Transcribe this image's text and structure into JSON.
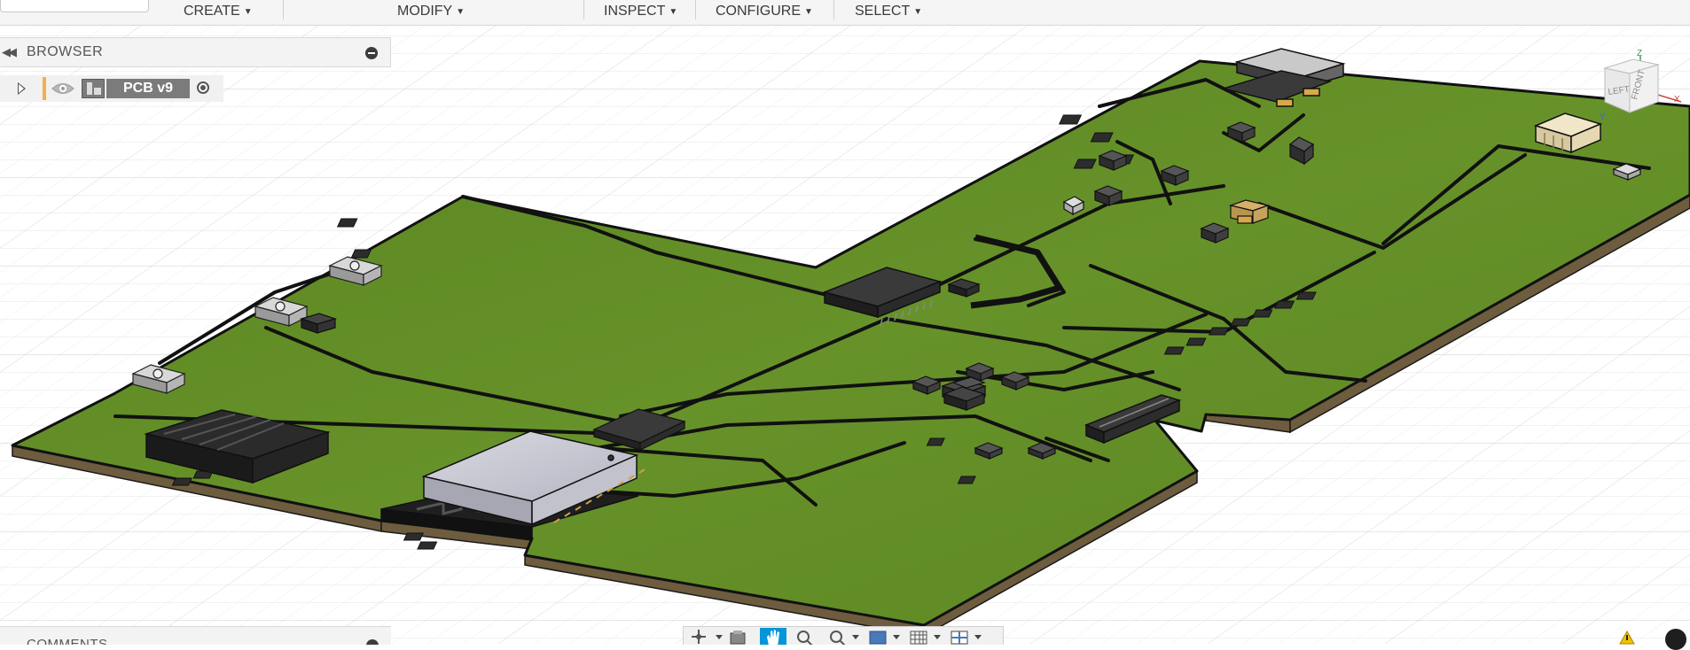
{
  "toolbar": {
    "menus": [
      {
        "label": "CREATE"
      },
      {
        "label": "MODIFY"
      },
      {
        "label": "INSPECT"
      },
      {
        "label": "CONFIGURE"
      },
      {
        "label": "SELECT"
      }
    ]
  },
  "browser": {
    "title": "BROWSER",
    "tree": [
      {
        "label": "PCB v9"
      }
    ]
  },
  "comments": {
    "title": "COMMENTS"
  },
  "viewcube": {
    "left_face": "LEFT",
    "front_face": "FRONT",
    "axis_z": "Z",
    "axis_x": "X",
    "axis_y": "Y"
  },
  "icons": {
    "collapse": "double-chevron-left-icon",
    "pin": "panel-pin-icon",
    "visibility": "eye-icon",
    "component": "component-icon",
    "activate": "radio-activate-icon",
    "orbit": "orbit-icon",
    "look_at": "look-at-icon",
    "pan": "hand-pan-icon",
    "zoom": "zoom-icon",
    "fit": "zoom-window-icon",
    "display_mode": "display-settings-icon",
    "grid": "grid-settings-icon",
    "viewports": "viewports-icon",
    "warning": "warning-icon"
  },
  "colors": {
    "board": "#5f8a22",
    "board_dark": "#4d731a",
    "trace": "#111111",
    "board_edge": "#6d5c3e",
    "accent_active": "#0696d7",
    "browser_accent": "#f3b04a"
  }
}
